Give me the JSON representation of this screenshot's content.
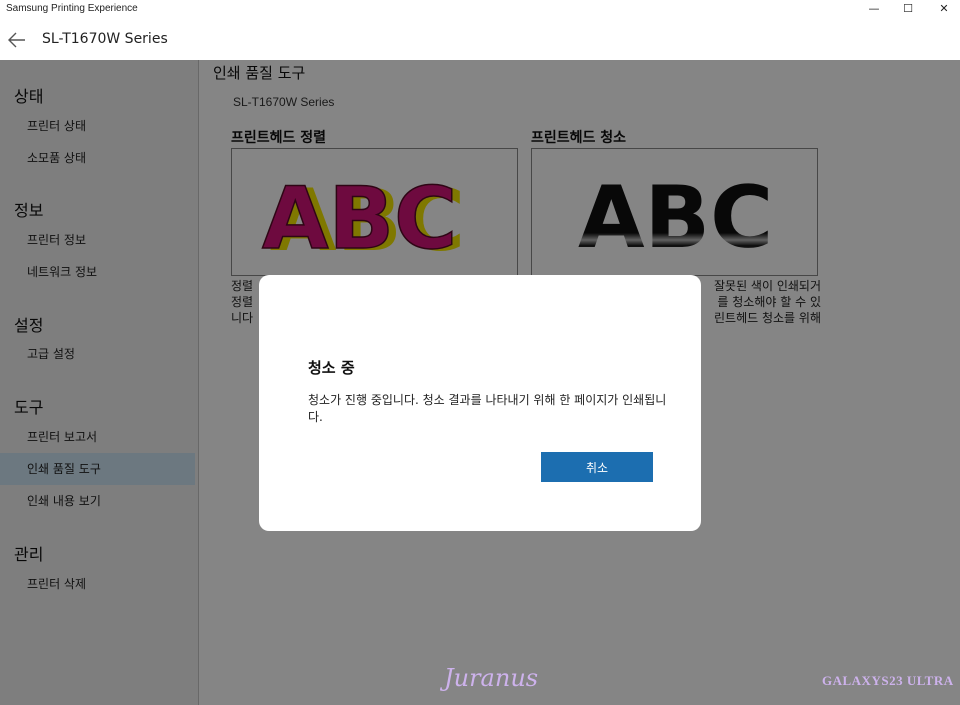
{
  "window": {
    "app_title": "Samsung Printing Experience",
    "controls": {
      "minimize": "—",
      "maximize": "☐",
      "close": "✕"
    }
  },
  "header": {
    "device_name": "SL-T1670W Series"
  },
  "sidebar": {
    "sections": [
      {
        "title": "상태",
        "items": [
          "프린터 상태",
          "소모품 상태"
        ]
      },
      {
        "title": "정보",
        "items": [
          "프린터 정보",
          "네트워크 정보"
        ]
      },
      {
        "title": "설정",
        "items": [
          "고급 설정"
        ]
      },
      {
        "title": "도구",
        "items": [
          "프린터 보고서",
          "인쇄 품질 도구",
          "인쇄 내용 보기"
        ]
      },
      {
        "title": "관리",
        "items": [
          "프린터 삭제"
        ]
      }
    ],
    "selected_item": "인쇄 품질 도구"
  },
  "main": {
    "title": "인쇄 품질 도구",
    "device": "SL-T1670W Series",
    "cards": [
      {
        "title": "프린트헤드 정렬",
        "image_text": "ABC",
        "desc_lines": [
          "정렬",
          "정렬",
          "니다"
        ]
      },
      {
        "title": "프린트헤드 청소",
        "image_text": "ABC",
        "desc_lines": [
          "잘못된 색이 인쇄되거",
          "를 청소해야 할 수 있",
          "린트헤드 청소를 위해"
        ]
      }
    ]
  },
  "dialog": {
    "title": "청소 중",
    "message": "청소가 진행 중입니다. 청소 결과를 나타내기 위해 한 페이지가 인쇄됩니다.",
    "cancel_label": "취소"
  },
  "watermarks": {
    "left": "Juranus",
    "right": "GALAXYS23 ULTRA"
  },
  "colors": {
    "accent": "#1c6eb0",
    "selected_bg": "#cfe6f5",
    "magenta": "#d4147a",
    "yellow": "#f3e600"
  }
}
